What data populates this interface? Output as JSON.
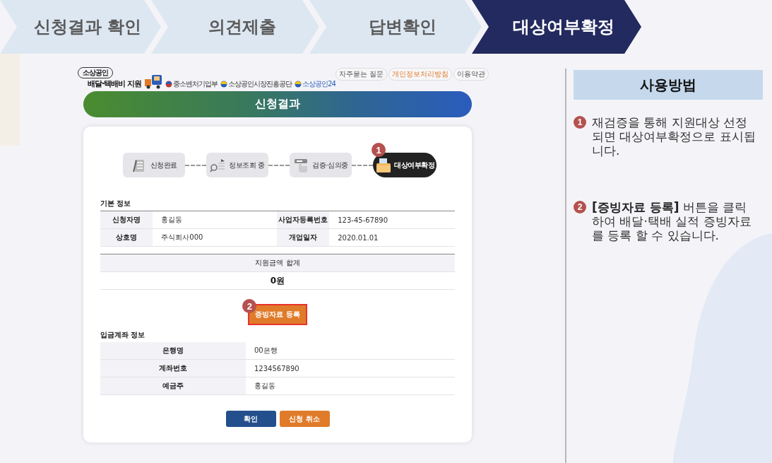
{
  "steps_nav": [
    {
      "label": "신청결과 확인",
      "selected": false
    },
    {
      "label": "의견제출",
      "selected": false
    },
    {
      "label": "답변확인",
      "selected": false
    },
    {
      "label": "대상여부확정",
      "selected": true
    }
  ],
  "site_header": {
    "logo_top": "소상공인",
    "logo_bottom": "배달·택배비 지원",
    "partners": [
      "중소벤처기업부",
      "소상공인시장진흥공단",
      "소상공인24"
    ],
    "links": [
      "자주묻는 질문",
      "개인정보처리방침",
      "이용약관"
    ]
  },
  "page_title": "신청결과",
  "progress": [
    {
      "label": "신청완료",
      "selected": false
    },
    {
      "label": "정보조회 중",
      "selected": false
    },
    {
      "label": "검증·심의중",
      "selected": false
    },
    {
      "label": "대상여부확정",
      "selected": true,
      "callout": "1"
    }
  ],
  "basic_info": {
    "title": "기본 정보",
    "rows": [
      [
        {
          "label": "신청자명",
          "value": "홍길동"
        },
        {
          "label": "사업자등록번호",
          "value": "123-45-67890"
        }
      ],
      [
        {
          "label": "상호명",
          "value": "주식회사000"
        },
        {
          "label": "개업일자",
          "value": "2020.01.01"
        }
      ]
    ]
  },
  "total": {
    "label": "지원금액 합계",
    "value": "0원"
  },
  "evidence_button": {
    "label": "증빙자료 등록",
    "callout": "2",
    "highlighted": true
  },
  "account_info": {
    "title": "입금계좌 정보",
    "rows": [
      {
        "label": "은행명",
        "value": "00은행"
      },
      {
        "label": "계좌번호",
        "value": "1234567890"
      },
      {
        "label": "예금주",
        "value": "홍길동"
      }
    ]
  },
  "buttons": [
    {
      "label": "확인",
      "kind": "primary"
    },
    {
      "label": "신청 취소",
      "kind": "secondary"
    }
  ],
  "help": {
    "title": "사용방법",
    "items": [
      {
        "number": "1",
        "text": "재검증을 통해 지원대상 선정되면 대상여부확정으로 표시됩니다."
      },
      {
        "number": "2",
        "text": "**[증빙자료 등록]** 버튼을 클릭하여 배달·택배 실적 증빙자료를 등록 할 수 있습니다."
      }
    ]
  }
}
